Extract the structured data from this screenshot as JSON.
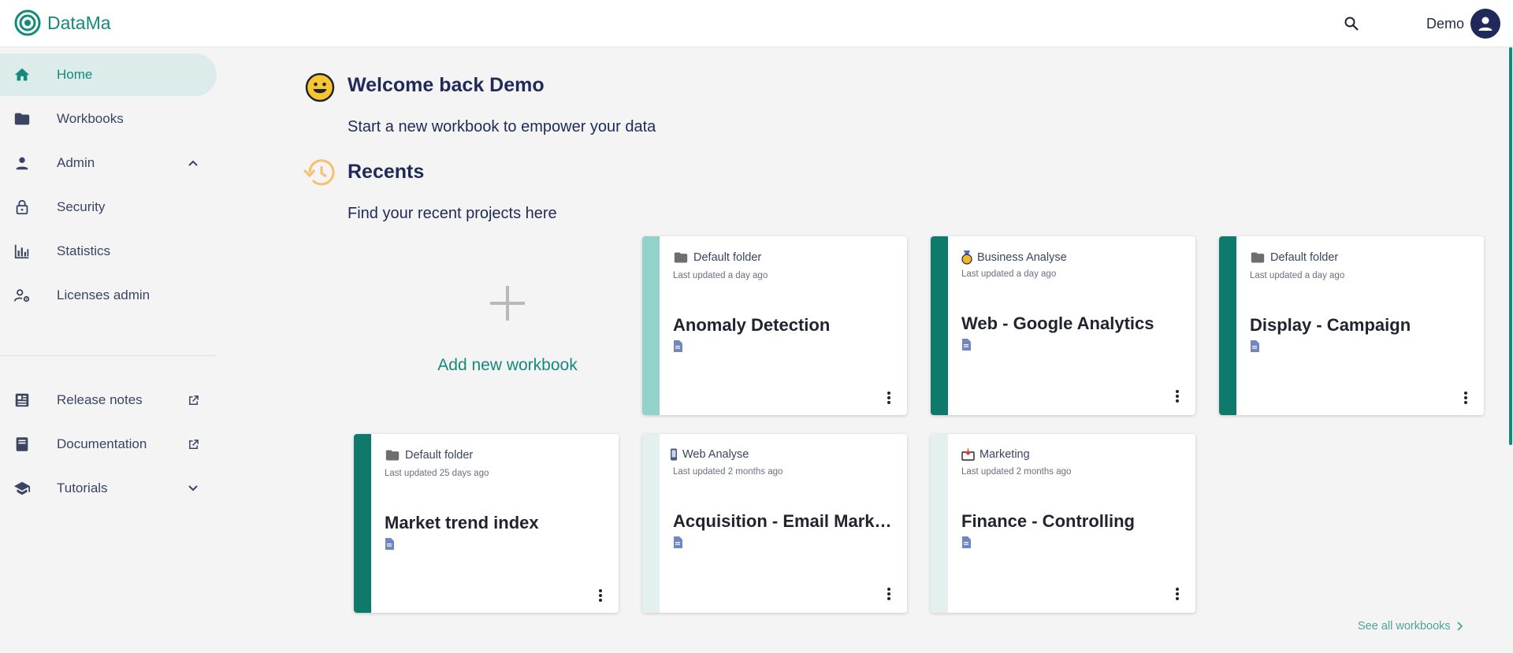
{
  "app": {
    "name": "DataMa"
  },
  "header": {
    "user_name": "Demo"
  },
  "sidebar": {
    "items": [
      {
        "label": "Home",
        "icon": "home-icon"
      },
      {
        "label": "Workbooks",
        "icon": "folder-icon"
      },
      {
        "label": "Admin",
        "icon": "person-icon"
      },
      {
        "label": "Security",
        "icon": "lock-icon"
      },
      {
        "label": "Statistics",
        "icon": "bar-chart-icon"
      },
      {
        "label": "Licenses admin",
        "icon": "user-settings-icon"
      }
    ],
    "bottom_items": [
      {
        "label": "Release notes",
        "icon": "newspaper-icon"
      },
      {
        "label": "Documentation",
        "icon": "book-icon"
      },
      {
        "label": "Tutorials",
        "icon": "school-icon"
      }
    ]
  },
  "main": {
    "welcome_title": "Welcome back Demo",
    "welcome_sub": "Start a new workbook to empower your data",
    "recents_title": "Recents",
    "recents_sub": "Find your recent projects here",
    "add_label": "Add new workbook",
    "see_all": "See all workbooks"
  },
  "workbooks": [
    {
      "folder": "Default folder",
      "folder_icon": "folder-icon",
      "updated": "Last updated a day ago",
      "title": "Anomaly Detection",
      "stripe": "#93d2ca"
    },
    {
      "folder": "Business Analyse",
      "folder_icon": "medal-icon",
      "updated": "Last updated a day ago",
      "title": "Web - Google Analytics",
      "stripe": "#0e7a6c"
    },
    {
      "folder": "Default folder",
      "folder_icon": "folder-icon",
      "updated": "Last updated a day ago",
      "title": "Display - Campaign",
      "stripe": "#0e7a6c"
    },
    {
      "folder": "Default folder",
      "folder_icon": "folder-icon",
      "updated": "Last updated 25 days ago",
      "title": "Market trend index",
      "stripe": "#0e7a6c"
    },
    {
      "folder": "Web Analyse",
      "folder_icon": "phone-icon",
      "updated": "Last updated 2 months ago",
      "title": "Acquisition - Email Marketing",
      "stripe": "#e4f0ef"
    },
    {
      "folder": "Marketing",
      "folder_icon": "inbox-icon",
      "updated": "Last updated 2 months ago",
      "title": "Finance - Controlling",
      "stripe": "#e4f0ef"
    }
  ],
  "colors": {
    "accent": "#138a7a",
    "navy": "#1f2a5a",
    "active_bg": "#dbecea"
  }
}
